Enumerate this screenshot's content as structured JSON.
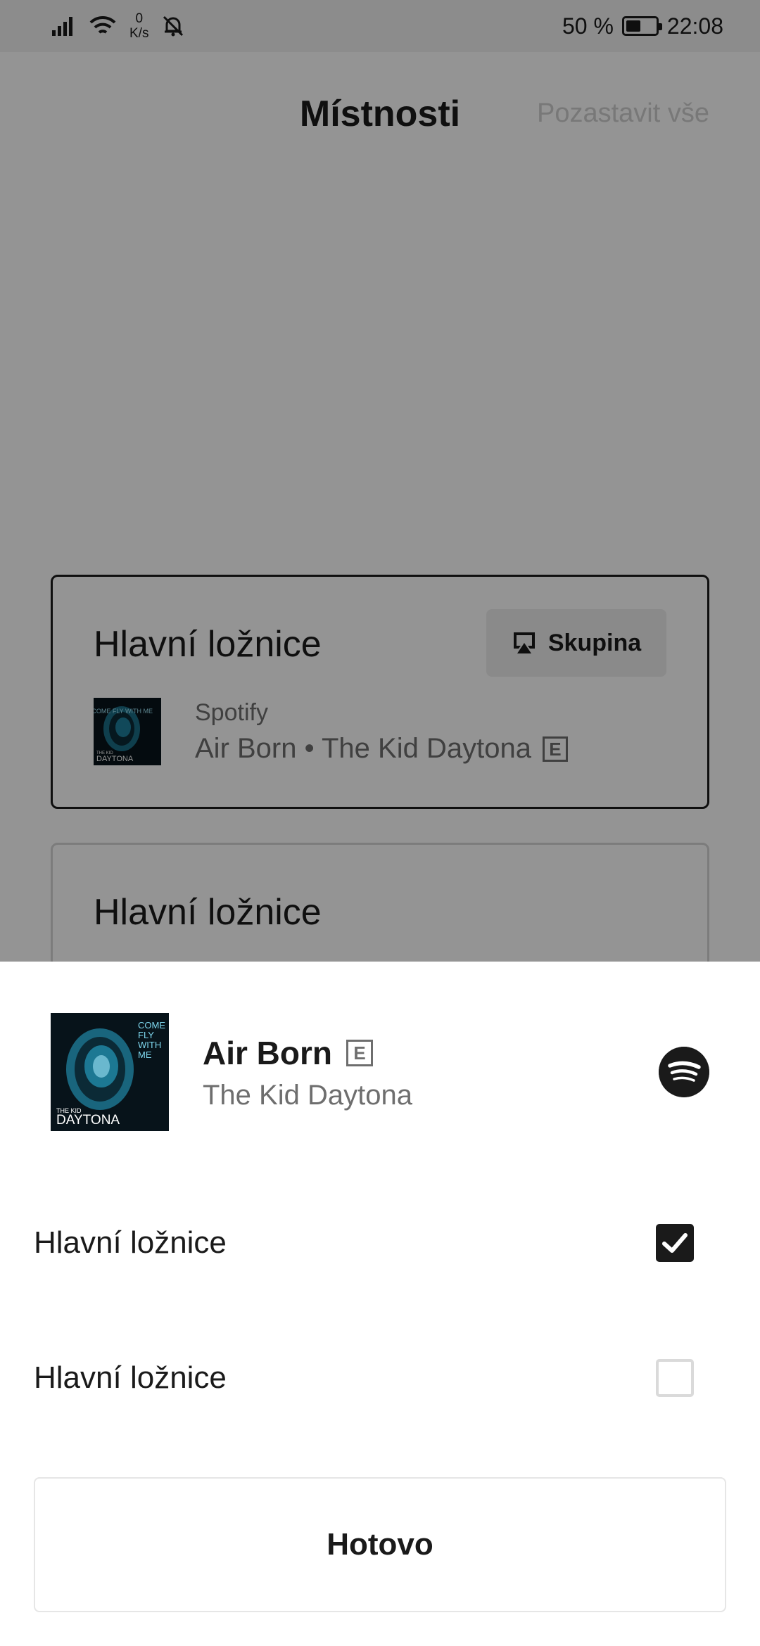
{
  "status_bar": {
    "net_speed_value": "0",
    "net_speed_unit": "K/s",
    "battery_text": "50 %",
    "battery_level": 0.5,
    "time": "22:08",
    "icons": [
      "signal-icon",
      "wifi-icon",
      "bell-off-icon",
      "battery-icon"
    ]
  },
  "header": {
    "title": "Místnosti",
    "pause_all_label": "Pozastavit vše"
  },
  "rooms": [
    {
      "name": "Hlavní ložnice",
      "group_label": "Skupina",
      "source": "Spotify",
      "now_playing": "Air Born • The Kid Daytona",
      "explicit_badge": "E",
      "album_art_text": [
        "COME FLY WITH ME",
        "THE KID",
        "DAYTONA"
      ]
    },
    {
      "name": "Hlavní ložnice"
    }
  ],
  "sheet": {
    "track_title": "Air Born",
    "explicit_badge": "E",
    "artist": "The Kid Daytona",
    "service_icon": "spotify-icon",
    "album_art_text": [
      "COME",
      "FLY",
      "WITH",
      "ME",
      "THE KID",
      "DAYTONA"
    ],
    "room_options": [
      {
        "label": "Hlavní ložnice",
        "checked": true
      },
      {
        "label": "Hlavní ložnice",
        "checked": false
      }
    ],
    "done_label": "Hotovo"
  },
  "colors": {
    "scrim": "#000000",
    "text_primary": "#1a1a1a",
    "text_secondary": "#6e6e6e",
    "album_accent": "#2bb8e0"
  }
}
